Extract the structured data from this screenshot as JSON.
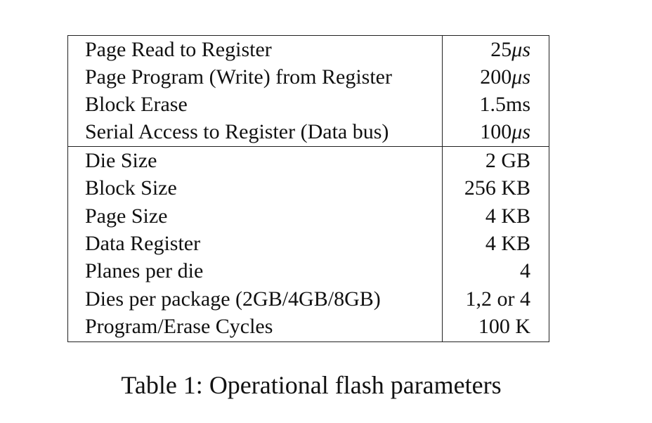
{
  "table": {
    "section1": [
      {
        "label": "Page Read to Register",
        "value_num": "25",
        "value_unit": "μs"
      },
      {
        "label": "Page Program (Write) from Register",
        "value_num": "200",
        "value_unit": "μs"
      },
      {
        "label": "Block Erase",
        "value_num": "1.5ms",
        "value_unit": ""
      },
      {
        "label": "Serial Access to Register (Data bus)",
        "value_num": "100",
        "value_unit": "μs"
      }
    ],
    "section2": [
      {
        "label": "Die Size",
        "value": "2 GB"
      },
      {
        "label": "Block Size",
        "value": "256 KB"
      },
      {
        "label": "Page Size",
        "value": "4 KB"
      },
      {
        "label": "Data Register",
        "value": "4 KB"
      },
      {
        "label": "Planes per die",
        "value": "4"
      },
      {
        "label": "Dies per package (2GB/4GB/8GB)",
        "value": "1,2 or 4"
      },
      {
        "label": "Program/Erase Cycles",
        "value": "100 K"
      }
    ]
  },
  "caption": "Table 1: Operational flash parameters"
}
